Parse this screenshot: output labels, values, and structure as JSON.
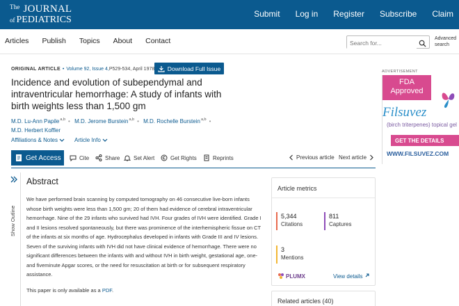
{
  "header": {
    "logo_the": "The",
    "logo_journal": "JOURNAL",
    "logo_of": "of",
    "logo_pediatrics": "PEDIATRICS",
    "nav": [
      "Submit",
      "Log in",
      "Register",
      "Subscribe",
      "Claim"
    ]
  },
  "subnav": {
    "links": [
      "Articles",
      "Publish",
      "Topics",
      "About",
      "Contact"
    ],
    "search_placeholder": "Search for...",
    "advanced_1": "Advanced",
    "advanced_2": "search"
  },
  "article": {
    "kind": "ORIGINAL ARTICLE",
    "volume": "Volume 92, Issue 4,",
    "pages": "P529-534, April 1978",
    "download_label": "Download Full Issue",
    "title": "Incidence and evolution of subependymal and intraventricular hemorrhage: A study of infants with birth weights less than 1,500 gm",
    "authors": [
      {
        "name": "M.D. Lu-Ann Papile",
        "sup": "a,b"
      },
      {
        "name": "M.D. Jerome Burstein",
        "sup": "a,b"
      },
      {
        "name": "M.D. Rochelle Burstein",
        "sup": "a,b"
      },
      {
        "name": "M.D. Herbert Koffler",
        "sup": ""
      }
    ],
    "affiliations_label": "Affiliations & Notes",
    "article_info_label": "Article Info"
  },
  "toolbar": {
    "get_access": "Get Access",
    "cite": "Cite",
    "share": "Share",
    "set_alert": "Set Alert",
    "get_rights": "Get Rights",
    "reprints": "Reprints",
    "previous": "Previous article",
    "next": "Next article"
  },
  "outline": {
    "label": "Show Outline"
  },
  "abstract": {
    "heading": "Abstract",
    "body": "We have performed brain scanning by computed tomography on 46 consecutive live-born infants whose birth weights were less than 1,500 gm; 20 of them had evidence of cerebral intraventricular hemorrhage. Nine of the 29 infants who survived had IVH. Four grades of IVH were identified. Grade I and II lesions resolved spontaneously, but there was prominence of the interhemispheric fissue on CT of the infants at six months of age. Hydrocephalus developed in infants with Grade III and IV lesions. Seven of the surviving infants with IVH did not have clinical evidence of hemorrhage. There were no significant differences between the infants with and without IVH in birth weight, gestational age, one- and fiveminute Apgar scores, or the need for resuscitation at birth or for subsequent respiratory assistance.",
    "note_prefix": "This paper is only available as a ",
    "note_link": "PDF",
    "note_suffix": "."
  },
  "metrics": {
    "heading": "Article metrics",
    "citations_value": "5,344",
    "citations_label": "Citations",
    "captures_value": "811",
    "captures_label": "Captures",
    "mentions_value": "3",
    "mentions_label": "Mentions",
    "plumx": "PLUMX",
    "view_details": "View details",
    "colors": {
      "citations": "#e86a4e",
      "captures": "#8e4cb8",
      "mentions": "#f2b632"
    }
  },
  "related": {
    "label": "Related articles (40)"
  },
  "ad": {
    "label": "ADVERTISEMENT",
    "fda_1": "FDA",
    "fda_2": "Approved",
    "brand": "Filsuvez",
    "sub": "(birch triterpenes) topical gel",
    "cta": "GET THE DETAILS",
    "url": "WWW.FILSUVEZ.COM"
  },
  "colors": {
    "brand_blue": "#0b5a8f",
    "ad_pink": "#d84a8f"
  }
}
